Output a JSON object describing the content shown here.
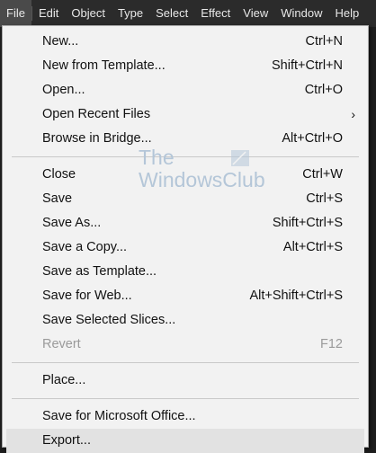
{
  "menubar": {
    "items": [
      "File",
      "Edit",
      "Object",
      "Type",
      "Select",
      "Effect",
      "View",
      "Window",
      "Help"
    ]
  },
  "file_menu": {
    "group1": [
      {
        "label": "New...",
        "shortcut": "Ctrl+N"
      },
      {
        "label": "New from Template...",
        "shortcut": "Shift+Ctrl+N"
      },
      {
        "label": "Open...",
        "shortcut": "Ctrl+O"
      },
      {
        "label": "Open Recent Files",
        "shortcut": "",
        "submenu_arrow": "›"
      },
      {
        "label": "Browse in Bridge...",
        "shortcut": "Alt+Ctrl+O"
      }
    ],
    "group2": [
      {
        "label": "Close",
        "shortcut": "Ctrl+W"
      },
      {
        "label": "Save",
        "shortcut": "Ctrl+S"
      },
      {
        "label": "Save As...",
        "shortcut": "Shift+Ctrl+S"
      },
      {
        "label": "Save a Copy...",
        "shortcut": "Alt+Ctrl+S"
      },
      {
        "label": "Save as Template...",
        "shortcut": ""
      },
      {
        "label": "Save for Web...",
        "shortcut": "Alt+Shift+Ctrl+S"
      },
      {
        "label": "Save Selected Slices...",
        "shortcut": ""
      },
      {
        "label": "Revert",
        "shortcut": "F12",
        "disabled": true
      }
    ],
    "group3": [
      {
        "label": "Place...",
        "shortcut": ""
      }
    ],
    "group4": [
      {
        "label": "Save for Microsoft Office...",
        "shortcut": ""
      },
      {
        "label": "Export...",
        "shortcut": "",
        "highlighted": true
      }
    ]
  },
  "watermark": {
    "line1": "The",
    "line2": "WindowsClub"
  },
  "colors": {
    "menu_bg": "#f2f2f2",
    "menubar_bg": "#2b2b2b",
    "watermark": "#b4c6d8",
    "highlight": "#e2e2e2"
  }
}
